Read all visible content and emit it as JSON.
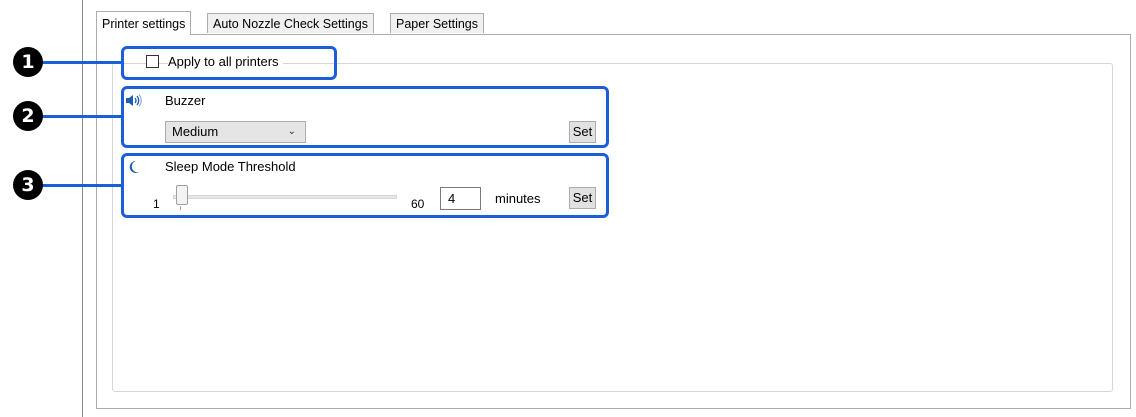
{
  "tabs": [
    {
      "label": "Printer settings",
      "active": true
    },
    {
      "label": "Auto Nozzle Check Settings",
      "active": false
    },
    {
      "label": "Paper Settings",
      "active": false
    }
  ],
  "apply_all": {
    "label": "Apply to all printers",
    "checked": false
  },
  "buzzer": {
    "icon": "speaker-icon",
    "title": "Buzzer",
    "selected": "Medium",
    "set_label": "Set"
  },
  "sleep": {
    "icon": "moon-icon",
    "title": "Sleep Mode Threshold",
    "min_label": "1",
    "max_label": "60",
    "slider_value": 4,
    "input_value": "4",
    "unit": "minutes",
    "set_label": "Set"
  },
  "callouts": [
    "1",
    "2",
    "3"
  ],
  "colors": {
    "highlight": "#1a5fd8",
    "marker": "#000000"
  }
}
